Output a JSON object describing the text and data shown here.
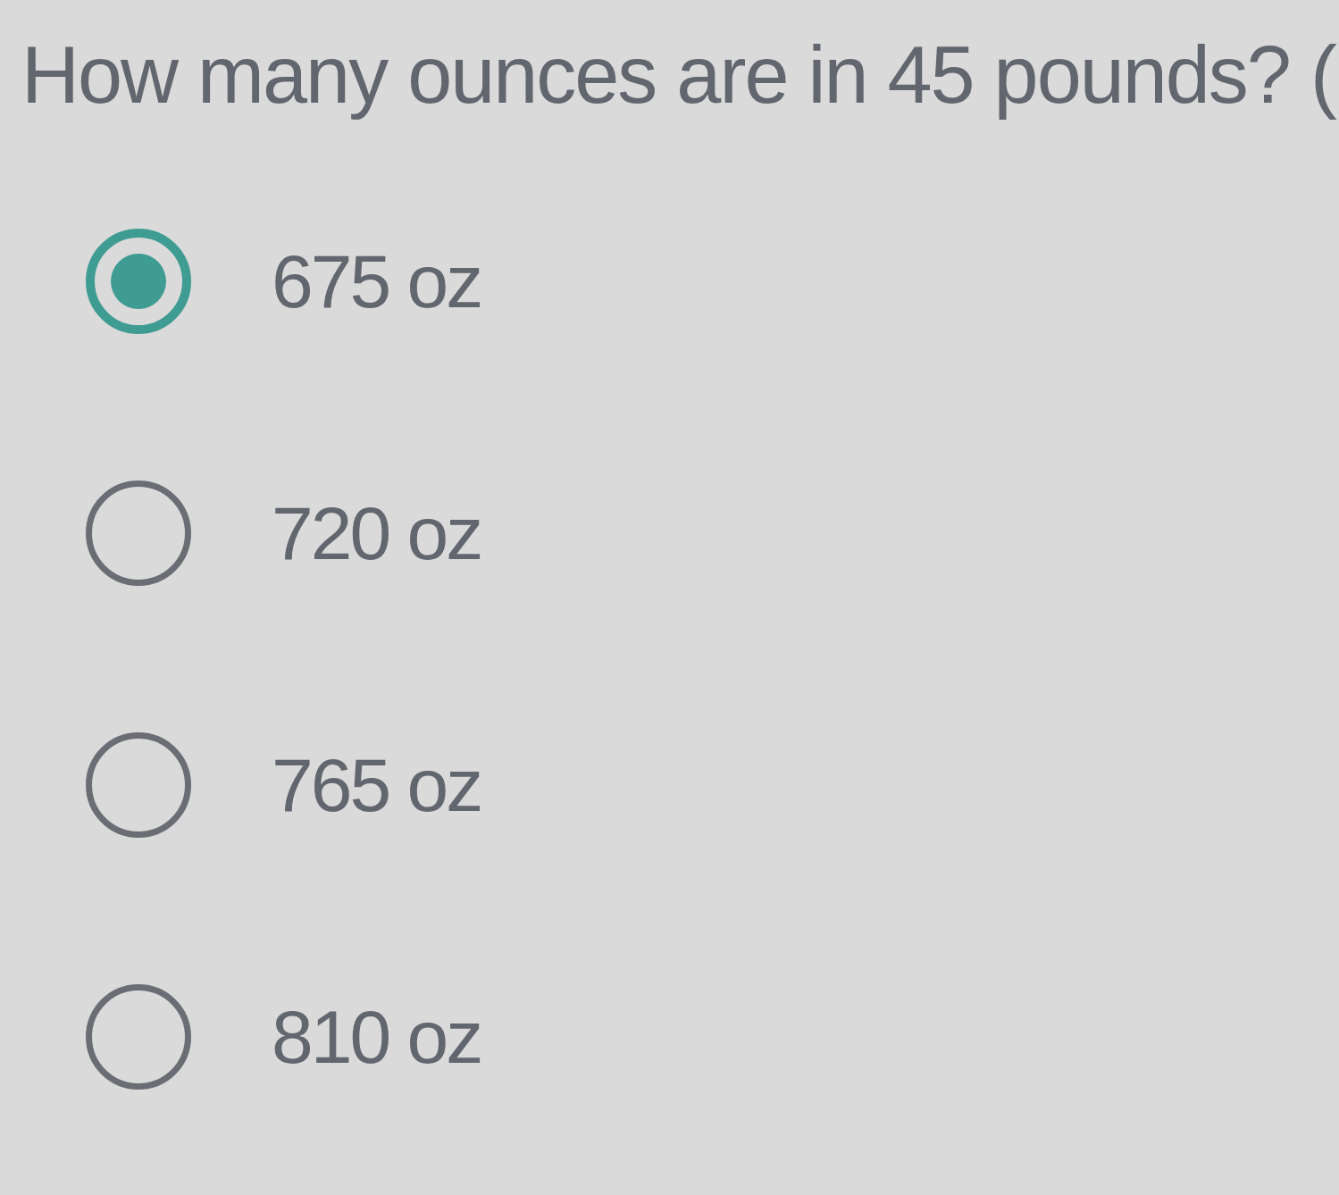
{
  "question": {
    "text": "How many ounces are in 45 pounds? ("
  },
  "options": [
    {
      "label": "675 oz",
      "selected": true
    },
    {
      "label": "720 oz",
      "selected": false
    },
    {
      "label": "765 oz",
      "selected": false
    },
    {
      "label": "810 oz",
      "selected": false
    }
  ]
}
